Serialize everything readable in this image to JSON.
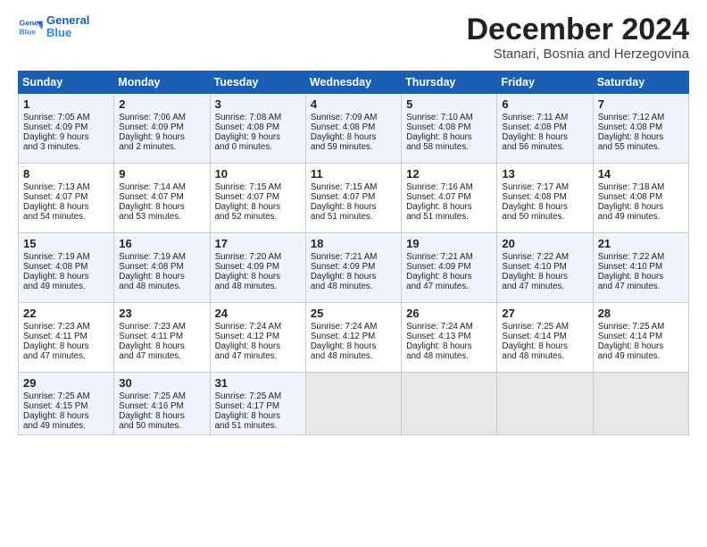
{
  "header": {
    "logo_line1": "General",
    "logo_line2": "Blue",
    "month": "December 2024",
    "location": "Stanari, Bosnia and Herzegovina"
  },
  "weekdays": [
    "Sunday",
    "Monday",
    "Tuesday",
    "Wednesday",
    "Thursday",
    "Friday",
    "Saturday"
  ],
  "weeks": [
    [
      {
        "day": "1",
        "lines": [
          "Sunrise: 7:05 AM",
          "Sunset: 4:09 PM",
          "Daylight: 9 hours",
          "and 3 minutes."
        ]
      },
      {
        "day": "2",
        "lines": [
          "Sunrise: 7:06 AM",
          "Sunset: 4:09 PM",
          "Daylight: 9 hours",
          "and 2 minutes."
        ]
      },
      {
        "day": "3",
        "lines": [
          "Sunrise: 7:08 AM",
          "Sunset: 4:08 PM",
          "Daylight: 9 hours",
          "and 0 minutes."
        ]
      },
      {
        "day": "4",
        "lines": [
          "Sunrise: 7:09 AM",
          "Sunset: 4:08 PM",
          "Daylight: 8 hours",
          "and 59 minutes."
        ]
      },
      {
        "day": "5",
        "lines": [
          "Sunrise: 7:10 AM",
          "Sunset: 4:08 PM",
          "Daylight: 8 hours",
          "and 58 minutes."
        ]
      },
      {
        "day": "6",
        "lines": [
          "Sunrise: 7:11 AM",
          "Sunset: 4:08 PM",
          "Daylight: 8 hours",
          "and 56 minutes."
        ]
      },
      {
        "day": "7",
        "lines": [
          "Sunrise: 7:12 AM",
          "Sunset: 4:08 PM",
          "Daylight: 8 hours",
          "and 55 minutes."
        ]
      }
    ],
    [
      {
        "day": "8",
        "lines": [
          "Sunrise: 7:13 AM",
          "Sunset: 4:07 PM",
          "Daylight: 8 hours",
          "and 54 minutes."
        ]
      },
      {
        "day": "9",
        "lines": [
          "Sunrise: 7:14 AM",
          "Sunset: 4:07 PM",
          "Daylight: 8 hours",
          "and 53 minutes."
        ]
      },
      {
        "day": "10",
        "lines": [
          "Sunrise: 7:15 AM",
          "Sunset: 4:07 PM",
          "Daylight: 8 hours",
          "and 52 minutes."
        ]
      },
      {
        "day": "11",
        "lines": [
          "Sunrise: 7:15 AM",
          "Sunset: 4:07 PM",
          "Daylight: 8 hours",
          "and 51 minutes."
        ]
      },
      {
        "day": "12",
        "lines": [
          "Sunrise: 7:16 AM",
          "Sunset: 4:07 PM",
          "Daylight: 8 hours",
          "and 51 minutes."
        ]
      },
      {
        "day": "13",
        "lines": [
          "Sunrise: 7:17 AM",
          "Sunset: 4:08 PM",
          "Daylight: 8 hours",
          "and 50 minutes."
        ]
      },
      {
        "day": "14",
        "lines": [
          "Sunrise: 7:18 AM",
          "Sunset: 4:08 PM",
          "Daylight: 8 hours",
          "and 49 minutes."
        ]
      }
    ],
    [
      {
        "day": "15",
        "lines": [
          "Sunrise: 7:19 AM",
          "Sunset: 4:08 PM",
          "Daylight: 8 hours",
          "and 49 minutes."
        ]
      },
      {
        "day": "16",
        "lines": [
          "Sunrise: 7:19 AM",
          "Sunset: 4:08 PM",
          "Daylight: 8 hours",
          "and 48 minutes."
        ]
      },
      {
        "day": "17",
        "lines": [
          "Sunrise: 7:20 AM",
          "Sunset: 4:09 PM",
          "Daylight: 8 hours",
          "and 48 minutes."
        ]
      },
      {
        "day": "18",
        "lines": [
          "Sunrise: 7:21 AM",
          "Sunset: 4:09 PM",
          "Daylight: 8 hours",
          "and 48 minutes."
        ]
      },
      {
        "day": "19",
        "lines": [
          "Sunrise: 7:21 AM",
          "Sunset: 4:09 PM",
          "Daylight: 8 hours",
          "and 47 minutes."
        ]
      },
      {
        "day": "20",
        "lines": [
          "Sunrise: 7:22 AM",
          "Sunset: 4:10 PM",
          "Daylight: 8 hours",
          "and 47 minutes."
        ]
      },
      {
        "day": "21",
        "lines": [
          "Sunrise: 7:22 AM",
          "Sunset: 4:10 PM",
          "Daylight: 8 hours",
          "and 47 minutes."
        ]
      }
    ],
    [
      {
        "day": "22",
        "lines": [
          "Sunrise: 7:23 AM",
          "Sunset: 4:11 PM",
          "Daylight: 8 hours",
          "and 47 minutes."
        ]
      },
      {
        "day": "23",
        "lines": [
          "Sunrise: 7:23 AM",
          "Sunset: 4:11 PM",
          "Daylight: 8 hours",
          "and 47 minutes."
        ]
      },
      {
        "day": "24",
        "lines": [
          "Sunrise: 7:24 AM",
          "Sunset: 4:12 PM",
          "Daylight: 8 hours",
          "and 47 minutes."
        ]
      },
      {
        "day": "25",
        "lines": [
          "Sunrise: 7:24 AM",
          "Sunset: 4:12 PM",
          "Daylight: 8 hours",
          "and 48 minutes."
        ]
      },
      {
        "day": "26",
        "lines": [
          "Sunrise: 7:24 AM",
          "Sunset: 4:13 PM",
          "Daylight: 8 hours",
          "and 48 minutes."
        ]
      },
      {
        "day": "27",
        "lines": [
          "Sunrise: 7:25 AM",
          "Sunset: 4:14 PM",
          "Daylight: 8 hours",
          "and 48 minutes."
        ]
      },
      {
        "day": "28",
        "lines": [
          "Sunrise: 7:25 AM",
          "Sunset: 4:14 PM",
          "Daylight: 8 hours",
          "and 49 minutes."
        ]
      }
    ],
    [
      {
        "day": "29",
        "lines": [
          "Sunrise: 7:25 AM",
          "Sunset: 4:15 PM",
          "Daylight: 8 hours",
          "and 49 minutes."
        ]
      },
      {
        "day": "30",
        "lines": [
          "Sunrise: 7:25 AM",
          "Sunset: 4:16 PM",
          "Daylight: 8 hours",
          "and 50 minutes."
        ]
      },
      {
        "day": "31",
        "lines": [
          "Sunrise: 7:25 AM",
          "Sunset: 4:17 PM",
          "Daylight: 8 hours",
          "and 51 minutes."
        ]
      },
      {
        "day": "",
        "lines": []
      },
      {
        "day": "",
        "lines": []
      },
      {
        "day": "",
        "lines": []
      },
      {
        "day": "",
        "lines": []
      }
    ]
  ]
}
